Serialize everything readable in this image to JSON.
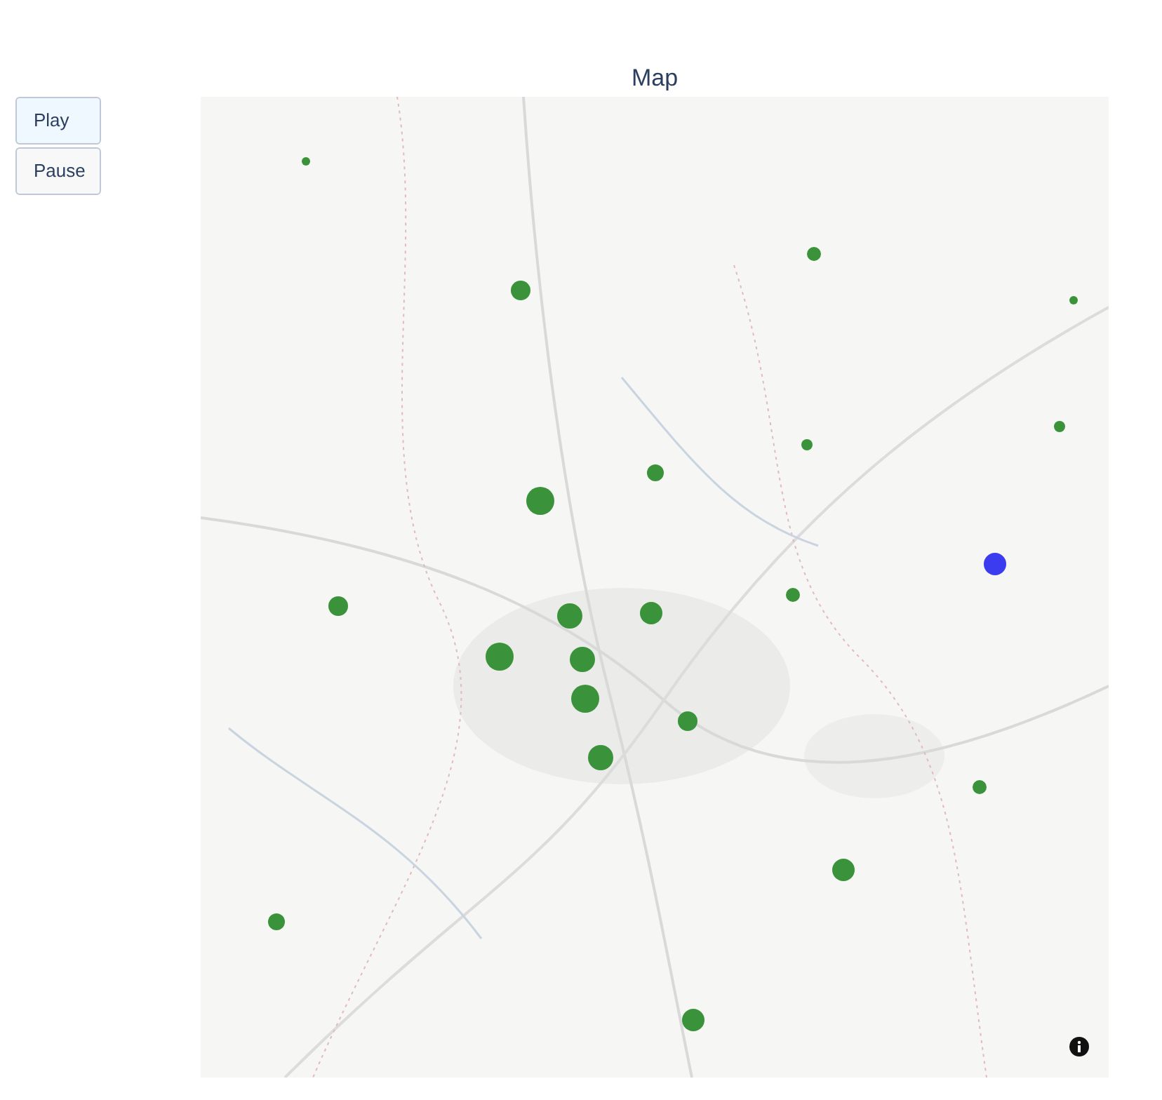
{
  "buttons": [
    {
      "label": "Play"
    },
    {
      "label": "Pause"
    }
  ],
  "chart": {
    "title": "Map",
    "markers": [
      {
        "color": "#3a933a"
      },
      {
        "color": "#3a933a"
      },
      {
        "color": "#3a933a"
      },
      {
        "color": "#3a933a"
      },
      {
        "color": "#3a933a"
      },
      {
        "color": "#3a933a"
      },
      {
        "color": "#3a933a"
      },
      {
        "color": "#3a933a"
      },
      {
        "color": "#3b3bf0"
      },
      {
        "color": "#3a933a"
      },
      {
        "color": "#3a933a"
      },
      {
        "color": "#3a933a"
      },
      {
        "color": "#3a933a"
      },
      {
        "color": "#3a933a"
      },
      {
        "color": "#3a933a"
      },
      {
        "color": "#3a933a"
      },
      {
        "color": "#3a933a"
      },
      {
        "color": "#3a933a"
      },
      {
        "color": "#3a933a"
      },
      {
        "color": "#3a933a"
      },
      {
        "color": "#3a933a"
      },
      {
        "color": "#3a933a"
      }
    ]
  }
}
